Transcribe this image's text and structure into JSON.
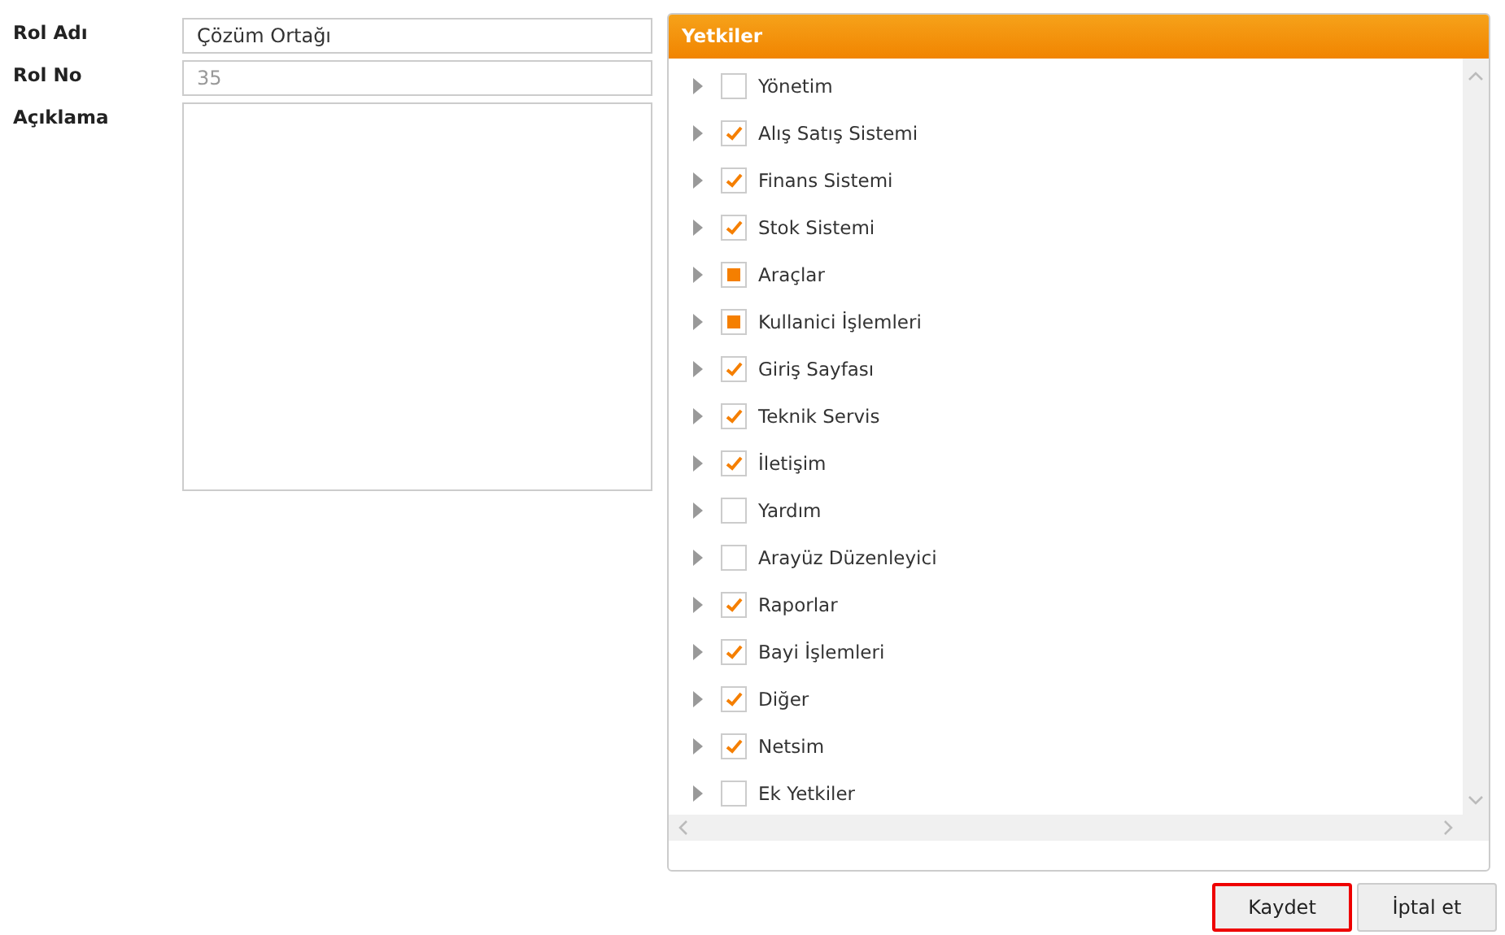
{
  "form": {
    "fields": [
      {
        "label": "Rol Adı",
        "kind": "text",
        "value": "Çözüm Ortağı",
        "disabled": false
      },
      {
        "label": "Rol No",
        "kind": "text",
        "value": "35",
        "disabled": true
      },
      {
        "label": "Açıklama",
        "kind": "textarea"
      }
    ]
  },
  "permissions": {
    "title": "Yetkiler",
    "items": [
      {
        "label": "Yönetim",
        "checked": false,
        "partial": false
      },
      {
        "label": "Alış Satış Sistemi",
        "checked": true,
        "partial": false
      },
      {
        "label": "Finans Sistemi",
        "checked": true,
        "partial": false
      },
      {
        "label": "Stok Sistemi",
        "checked": true,
        "partial": false
      },
      {
        "label": "Araçlar",
        "checked": false,
        "partial": true
      },
      {
        "label": "Kullanici İşlemleri",
        "checked": false,
        "partial": true
      },
      {
        "label": "Giriş Sayfası",
        "checked": true,
        "partial": false
      },
      {
        "label": "Teknik Servis",
        "checked": true,
        "partial": false
      },
      {
        "label": "İletişim",
        "checked": true,
        "partial": false
      },
      {
        "label": "Yardım",
        "checked": false,
        "partial": false
      },
      {
        "label": "Arayüz Düzenleyici",
        "checked": false,
        "partial": false
      },
      {
        "label": "Raporlar",
        "checked": true,
        "partial": false
      },
      {
        "label": "Bayi İşlemleri",
        "checked": true,
        "partial": false
      },
      {
        "label": "Diğer",
        "checked": true,
        "partial": false
      },
      {
        "label": "Netsim",
        "checked": true,
        "partial": false
      },
      {
        "label": "Ek Yetkiler",
        "checked": false,
        "partial": false
      }
    ]
  },
  "buttons": [
    {
      "label": "Kaydet",
      "focused": true
    },
    {
      "label": "İptal et",
      "focused": false
    }
  ]
}
